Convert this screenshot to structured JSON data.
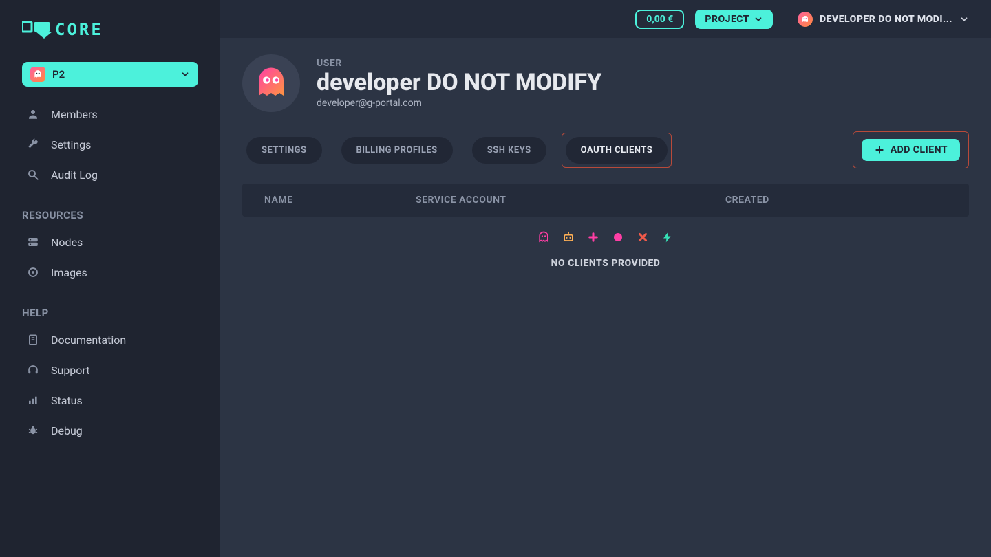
{
  "brand": "CORE",
  "sidebar": {
    "project_badge": "P2",
    "items": [
      {
        "label": "Members",
        "icon": "user-icon"
      },
      {
        "label": "Settings",
        "icon": "wrench-icon"
      },
      {
        "label": "Audit Log",
        "icon": "search-icon"
      }
    ],
    "sections": [
      {
        "title": "RESOURCES",
        "items": [
          {
            "label": "Nodes",
            "icon": "server-icon"
          },
          {
            "label": "Images",
            "icon": "disc-icon"
          }
        ]
      },
      {
        "title": "HELP",
        "items": [
          {
            "label": "Documentation",
            "icon": "book-icon"
          },
          {
            "label": "Support",
            "icon": "headset-icon"
          },
          {
            "label": "Status",
            "icon": "bars-icon"
          },
          {
            "label": "Debug",
            "icon": "bug-icon"
          }
        ]
      }
    ]
  },
  "topbar": {
    "balance": "0,00 €",
    "project_button": "PROJECT",
    "user_display": "DEVELOPER DO NOT MODI..."
  },
  "user": {
    "kicker": "USER",
    "name": "developer DO NOT MODIFY",
    "email": "developer@g-portal.com"
  },
  "tabs": [
    {
      "label": "SETTINGS",
      "active": false,
      "highlight": false
    },
    {
      "label": "BILLING PROFILES",
      "active": false,
      "highlight": false
    },
    {
      "label": "SSH KEYS",
      "active": false,
      "highlight": false
    },
    {
      "label": "OAUTH CLIENTS",
      "active": true,
      "highlight": true
    }
  ],
  "add_client_label": "ADD CLIENT",
  "table": {
    "columns": [
      "NAME",
      "SERVICE ACCOUNT",
      "CREATED"
    ],
    "empty_message": "NO CLIENTS PROVIDED"
  },
  "colors": {
    "accent": "#4cf1db",
    "highlight_border": "#b84a3a",
    "pink": "#ff3ea5",
    "orange": "#ffb055",
    "red": "#f05a4a",
    "teal": "#36e0b6"
  }
}
